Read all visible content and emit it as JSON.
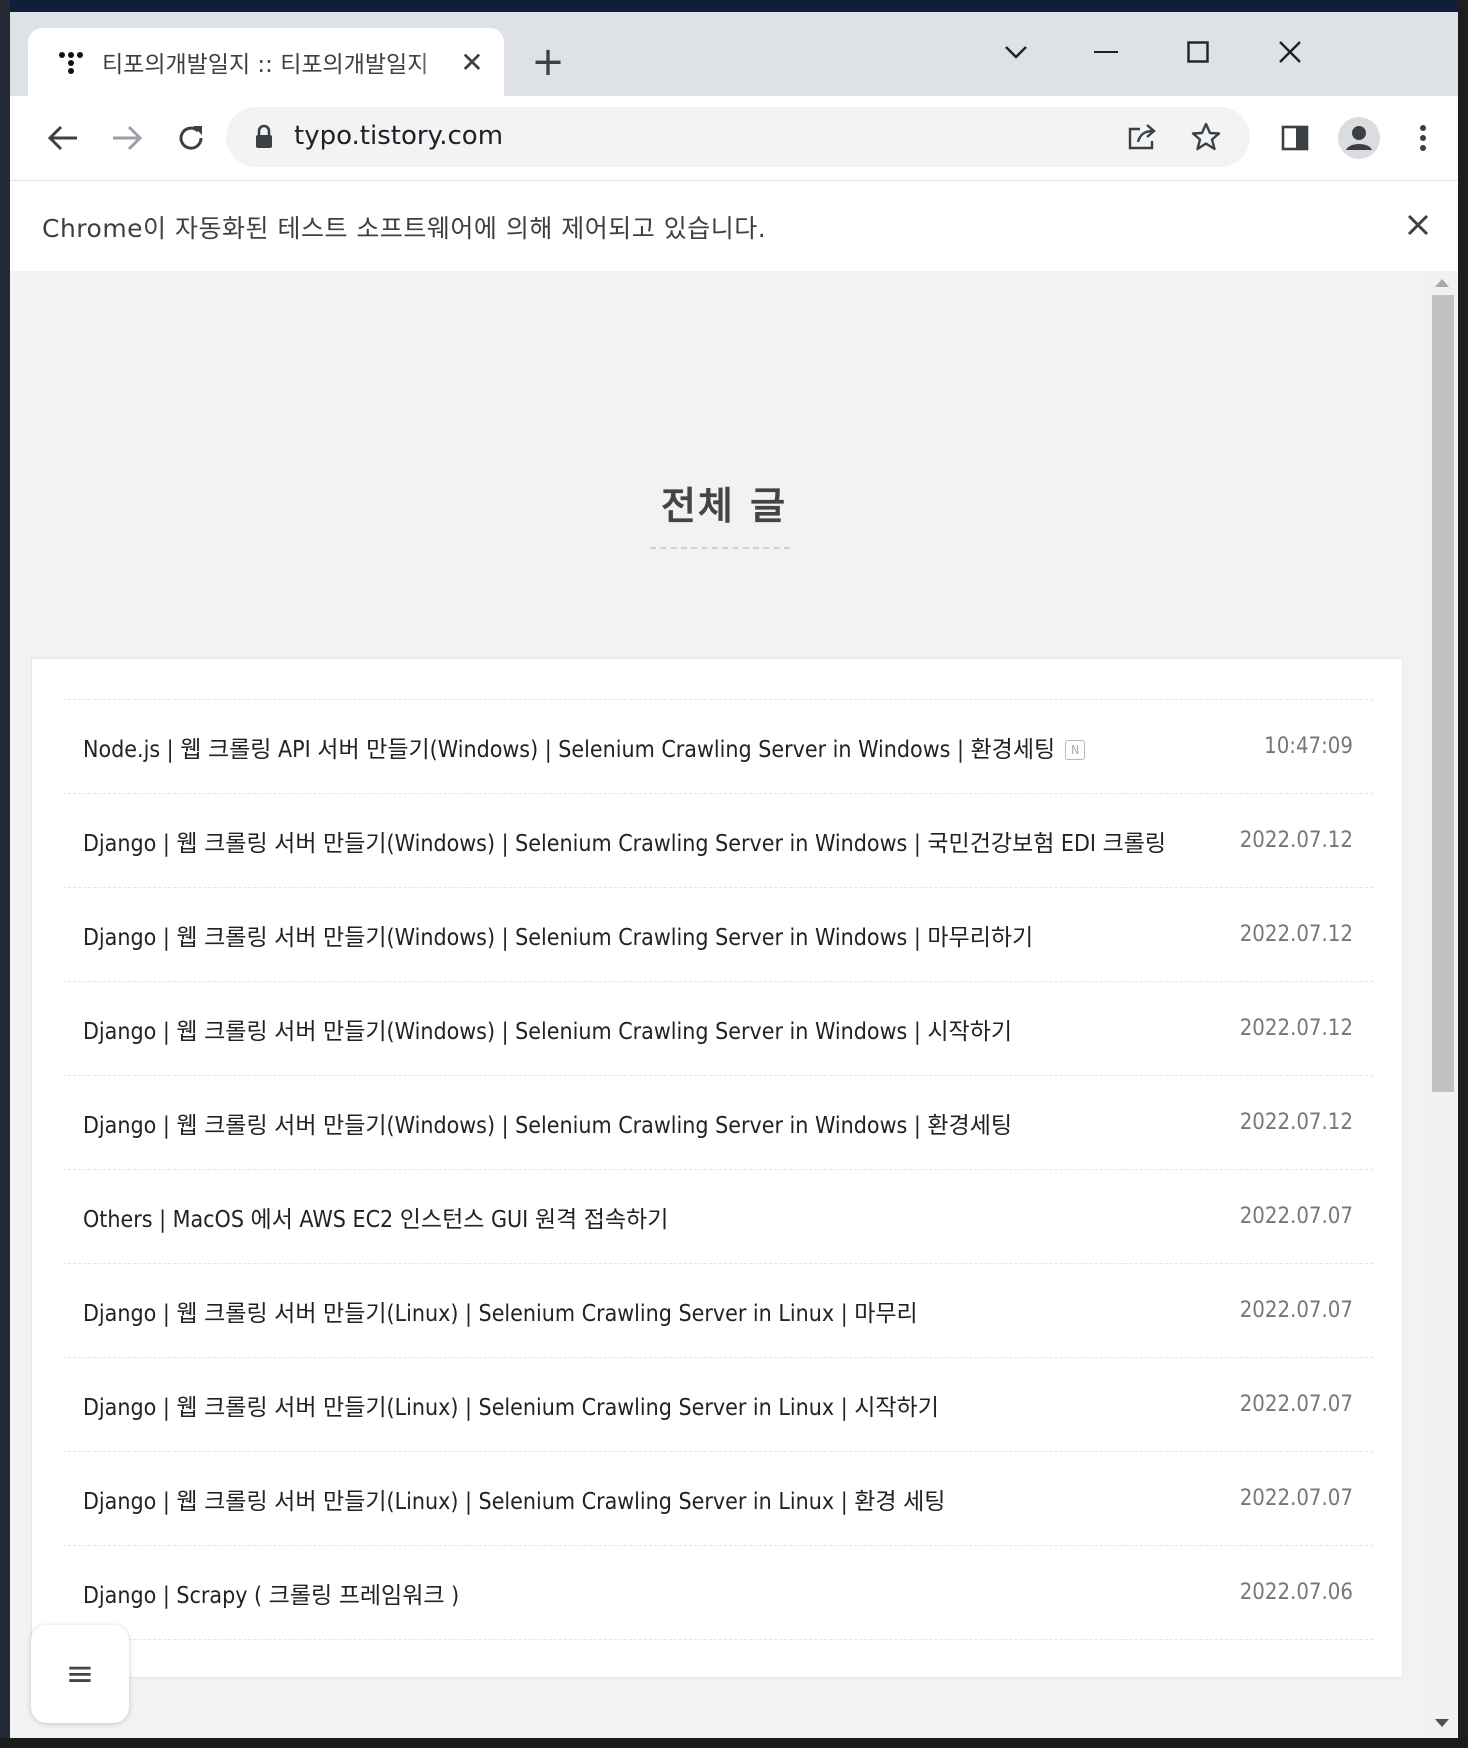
{
  "browser": {
    "tab_title": "티포의개발일지 :: 티포의개발일지",
    "url": "typo.tistory.com",
    "automation_notice": "Chrome이 자동화된 테스트 소프트웨어에 의해 제어되고 있습니다."
  },
  "page": {
    "heading": "전체 글",
    "posts": [
      {
        "title": "Node.js | 웹 크롤링 API 서버 만들기(Windows) | Selenium Crawling Server in Windows | 환경세팅",
        "badge": "N",
        "date": "10:47:09"
      },
      {
        "title": "Django | 웹 크롤링 서버 만들기(Windows) | Selenium Crawling Server in Windows | 국민건강보험 EDI 크롤링",
        "date": "2022.07.12"
      },
      {
        "title": "Django | 웹 크롤링 서버 만들기(Windows) | Selenium Crawling Server in Windows | 마무리하기",
        "date": "2022.07.12"
      },
      {
        "title": "Django | 웹 크롤링 서버 만들기(Windows) | Selenium Crawling Server in Windows | 시작하기",
        "date": "2022.07.12"
      },
      {
        "title": "Django | 웹 크롤링 서버 만들기(Windows) | Selenium Crawling Server in Windows | 환경세팅",
        "date": "2022.07.12"
      },
      {
        "title": "Others | MacOS 에서 AWS EC2 인스턴스 GUI 원격 접속하기",
        "date": "2022.07.07"
      },
      {
        "title": "Django | 웹 크롤링 서버 만들기(Linux) | Selenium Crawling Server in Linux | 마무리",
        "date": "2022.07.07"
      },
      {
        "title": "Django | 웹 크롤링 서버 만들기(Linux) | Selenium Crawling Server in Linux | 시작하기",
        "date": "2022.07.07"
      },
      {
        "title": "Django | 웹 크롤링 서버 만들기(Linux) | Selenium Crawling Server in Linux | 환경 세팅",
        "date": "2022.07.07"
      },
      {
        "title": "Django | Scrapy ( 크롤링 프레임워크 )",
        "date": "2022.07.06"
      }
    ]
  },
  "icons": {
    "menu": "≡",
    "tab_close": "✕",
    "new_tab": "+"
  }
}
